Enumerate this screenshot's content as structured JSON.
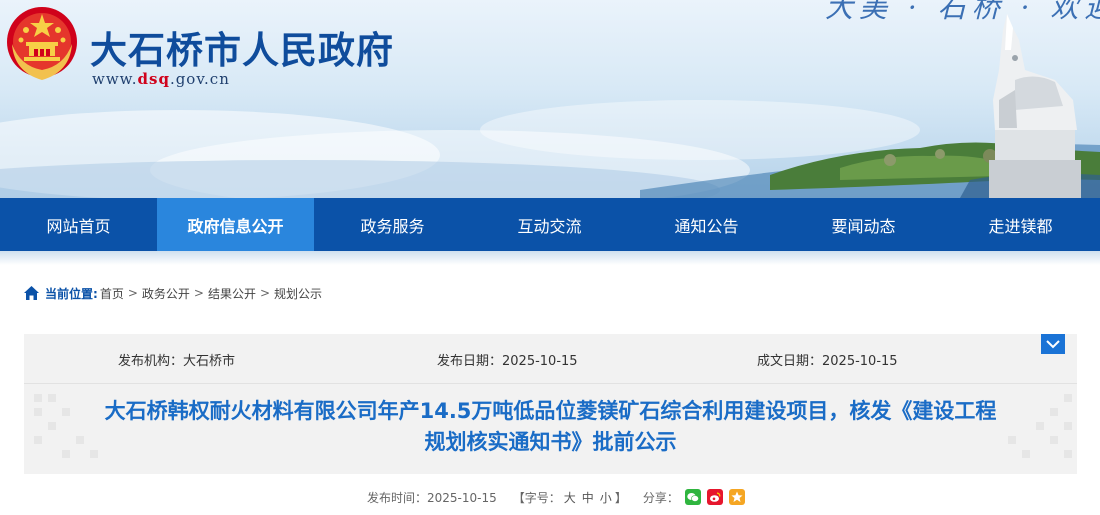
{
  "header": {
    "site_name": "大石桥市人民政府",
    "url_prefix": "www.",
    "url_highlight": "dsq",
    "url_suffix": ".gov.cn",
    "slogan": "大美 · 石桥 · 欢迎您"
  },
  "nav": {
    "items": [
      {
        "label": "网站首页",
        "active": false
      },
      {
        "label": "政府信息公开",
        "active": true
      },
      {
        "label": "政务服务",
        "active": false
      },
      {
        "label": "互动交流",
        "active": false
      },
      {
        "label": "通知公告",
        "active": false
      },
      {
        "label": "要闻动态",
        "active": false
      },
      {
        "label": "走进镁都",
        "active": false
      }
    ]
  },
  "breadcrumb": {
    "label": "当前位置:",
    "items": [
      "首页",
      "政务公开",
      "结果公开",
      "规划公示"
    ],
    "separator": ">"
  },
  "meta": {
    "publisher": "发布机构：大石桥市",
    "publish_date": "发布日期：2025-10-15",
    "created_date": "成文日期：2025-10-15"
  },
  "article": {
    "title_line1": "大石桥韩权耐火材料有限公司年产14.5万吨低品位菱镁矿石综合利用建设项目，核发《建设工程",
    "title_line2": "规划核实通知书》批前公示"
  },
  "info": {
    "publish_time": "发布时间：2025-10-15",
    "font_label": "【字号：",
    "font_large": "大",
    "font_medium": "中",
    "font_small": "小",
    "font_close": "】",
    "share_label": "分享："
  },
  "colors": {
    "nav_bg": "#0b52a8",
    "nav_active": "#2a86dd",
    "title_blue": "#1a6cc6",
    "brand_blue": "#0f4c9c"
  }
}
